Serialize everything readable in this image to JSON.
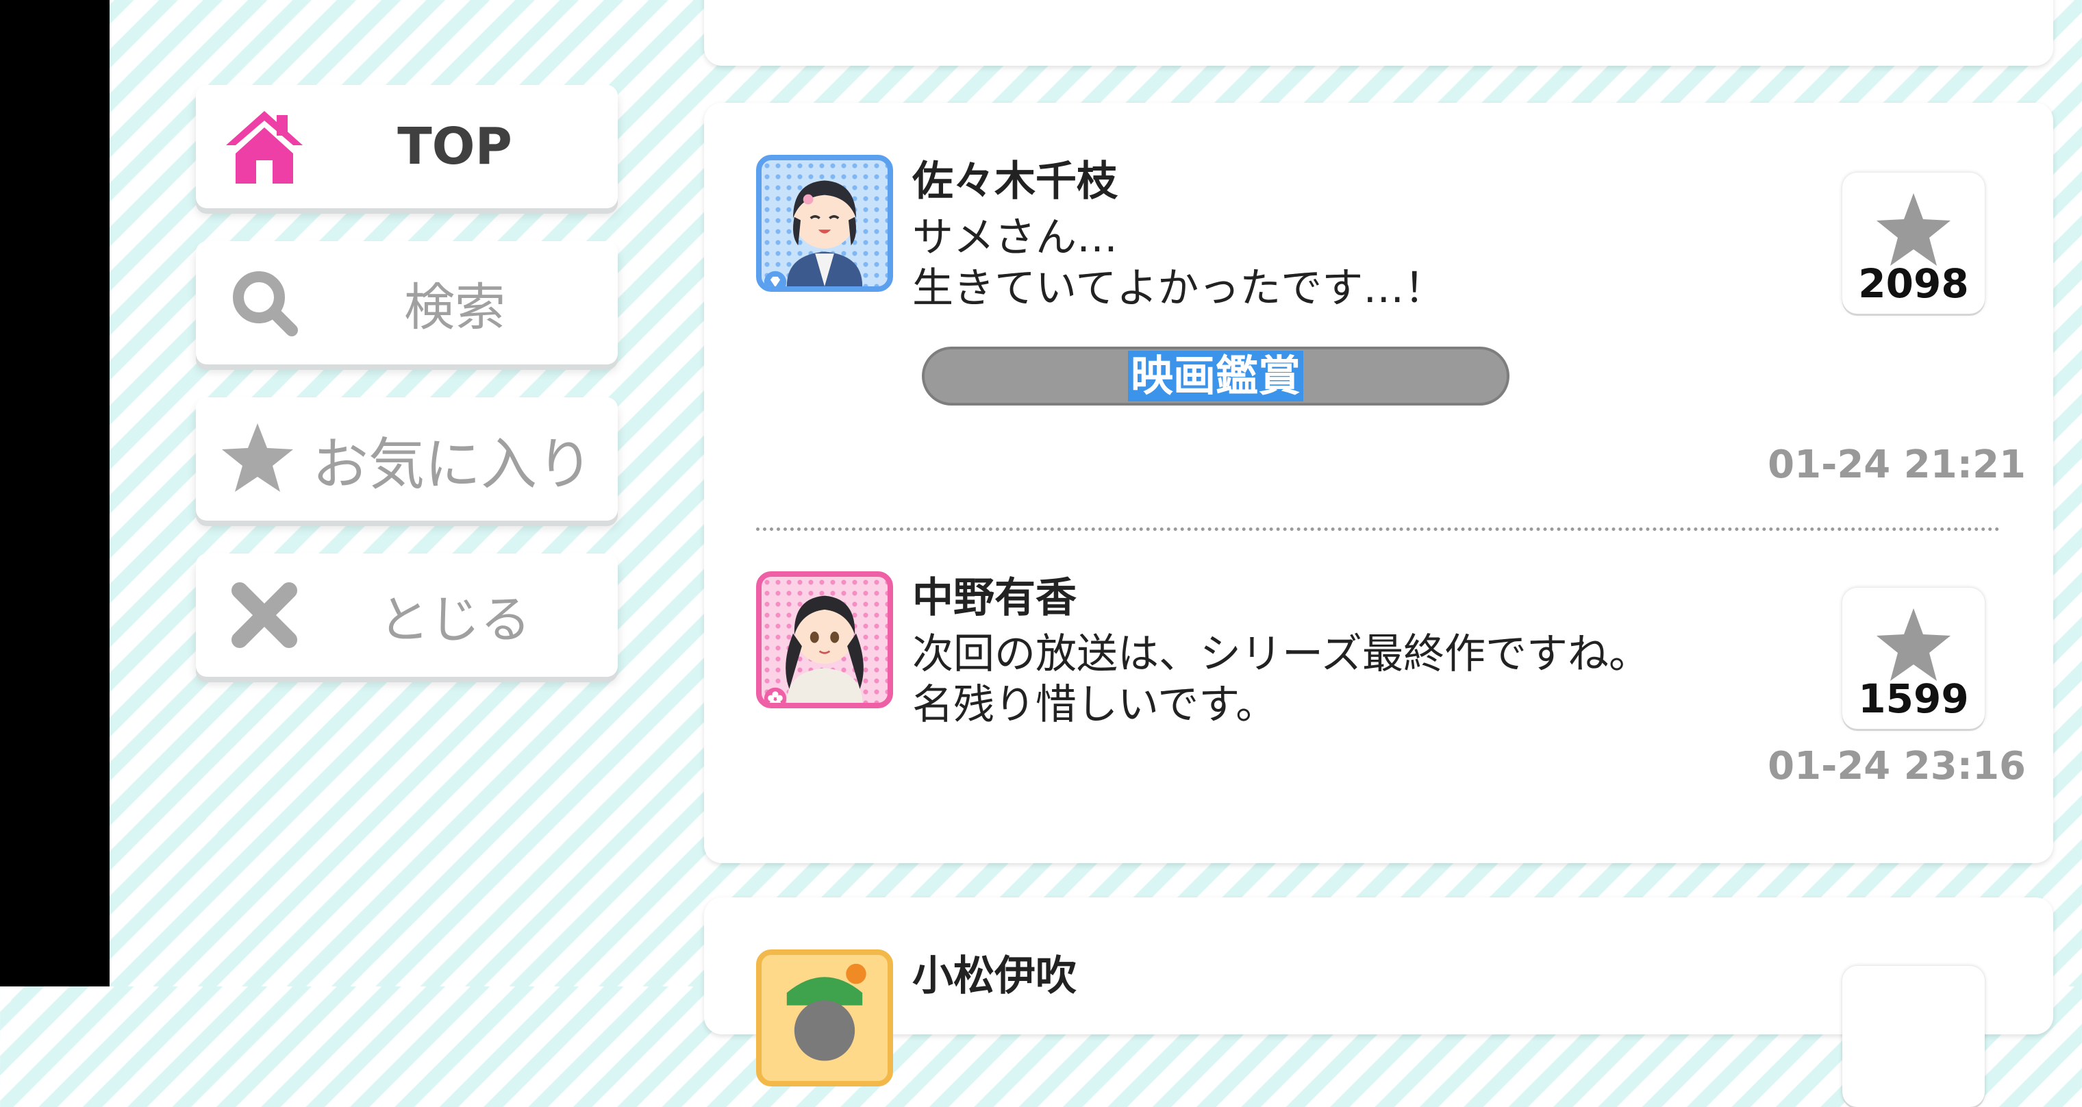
{
  "nav": {
    "top_label": "TOP",
    "search_label": "検索",
    "favorites_label": "お気に入り",
    "close_label": "とじる"
  },
  "colors": {
    "accent_pink": "#ee3fa6",
    "inactive_gray": "#a0a0a0",
    "tag_highlight": "#3b93ea"
  },
  "posts": [
    {
      "name": "佐々木千枝",
      "message_line1": "サメさん…",
      "message_line2": "生きていてよかったです…！",
      "tag": "映画鑑賞",
      "likes": "2098",
      "time": "01-24 21:21",
      "avatar_badge": "diamond-icon"
    },
    {
      "name": "中野有香",
      "message_line1": "次回の放送は、シリーズ最終作ですね。",
      "message_line2": "名残り惜しいです。",
      "likes": "1599",
      "time": "01-24 23:16",
      "avatar_badge": "flower-icon"
    },
    {
      "name": "小松伊吹"
    }
  ]
}
